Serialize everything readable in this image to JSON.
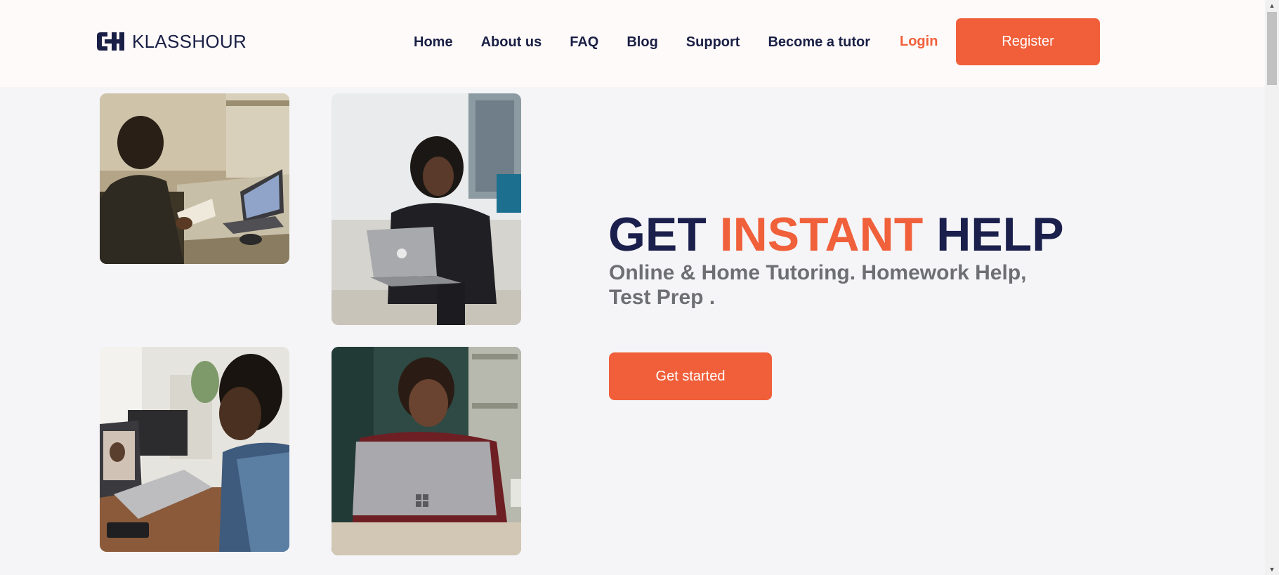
{
  "brand": {
    "name": "KLASSHOUR",
    "logo_icon": "klasshour-logo-icon"
  },
  "nav": {
    "items": [
      {
        "label": "Home"
      },
      {
        "label": "About us"
      },
      {
        "label": "FAQ"
      },
      {
        "label": "Blog"
      },
      {
        "label": "Support"
      },
      {
        "label": "Become a tutor"
      }
    ],
    "login_label": "Login",
    "register_label": "Register"
  },
  "hero": {
    "title_part1": "GET ",
    "title_accent": "INSTANT",
    "title_part2": " HELP",
    "subtitle": "Online & Home Tutoring. Homework Help, Test Prep .",
    "cta_label": "Get started"
  },
  "colors": {
    "accent": "#f05f3a",
    "navy": "#1a1f4c",
    "header_bg": "#fffafa",
    "page_bg": "#f5f5f8",
    "subtitle": "#6e6f72"
  }
}
